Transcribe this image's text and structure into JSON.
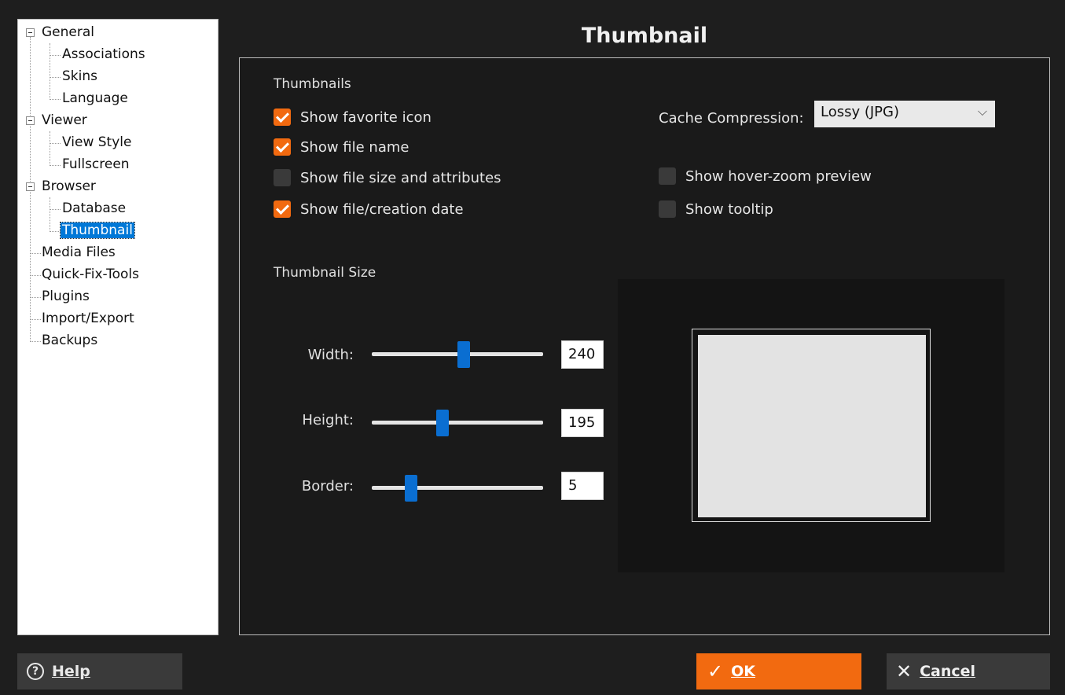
{
  "tree": {
    "items": [
      {
        "label": "General",
        "expandable": true
      },
      {
        "label": "Associations"
      },
      {
        "label": "Skins"
      },
      {
        "label": "Language"
      },
      {
        "label": "Viewer",
        "expandable": true
      },
      {
        "label": "View Style"
      },
      {
        "label": "Fullscreen"
      },
      {
        "label": "Browser",
        "expandable": true
      },
      {
        "label": "Database"
      },
      {
        "label": "Thumbnail",
        "selected": true
      },
      {
        "label": "Media Files"
      },
      {
        "label": "Quick-Fix-Tools"
      },
      {
        "label": "Plugins"
      },
      {
        "label": "Import/Export"
      },
      {
        "label": "Backups"
      }
    ]
  },
  "page_title": "Thumbnail",
  "thumbnails": {
    "section_label": "Thumbnails",
    "options": [
      {
        "label": "Show favorite icon",
        "checked": true
      },
      {
        "label": "Show file name",
        "checked": true
      },
      {
        "label": "Show file size and attributes",
        "checked": false
      },
      {
        "label": "Show file/creation date",
        "checked": true
      }
    ],
    "cache_compression_label": "Cache Compression:",
    "cache_compression_value": "Lossy (JPG)",
    "right_options": [
      {
        "label": "Show hover-zoom preview",
        "checked": false
      },
      {
        "label": "Show tooltip",
        "checked": false
      }
    ]
  },
  "size": {
    "section_label": "Thumbnail Size",
    "width_label": "Width:",
    "width_value": "240",
    "height_label": "Height:",
    "height_value": "195",
    "border_label": "Border:",
    "border_value": "5"
  },
  "buttons": {
    "help": "Help",
    "ok": "OK",
    "cancel": "Cancel"
  },
  "icons": {
    "help": "question-circle-icon",
    "ok": "checkmark-icon",
    "cancel": "x-icon",
    "chevron": "chevron-down-icon"
  },
  "colors": {
    "accent": "#f26a10",
    "slider_thumb": "#0a6ed1",
    "selection": "#0078d7"
  }
}
